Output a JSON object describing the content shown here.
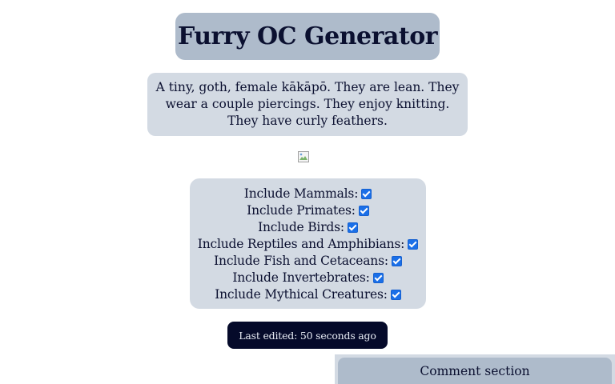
{
  "header": {
    "title": "Furry OC Generator"
  },
  "character": {
    "description": "A tiny, goth, female kākāpō. They are lean. They wear a couple piercings. They enjoy knitting. They have curly feathers."
  },
  "image": {
    "icon": "broken-image-icon"
  },
  "options": [
    {
      "label": "Include Mammals:",
      "checked": true
    },
    {
      "label": "Include Primates:",
      "checked": true
    },
    {
      "label": "Include Birds:",
      "checked": true
    },
    {
      "label": "Include Reptiles and Amphibians:",
      "checked": true
    },
    {
      "label": "Include Fish and Cetaceans:",
      "checked": true
    },
    {
      "label": "Include Invertebrates:",
      "checked": true
    },
    {
      "label": "Include Mythical Creatures:",
      "checked": true
    }
  ],
  "status": {
    "last_edited": "Last edited: 50 seconds ago"
  },
  "comments": {
    "header": "Comment section"
  },
  "colors": {
    "title_bg": "#aebbcb",
    "panel_bg": "#d3dae3",
    "status_bg": "#050a2a",
    "text": "#0b1030",
    "checkbox": "#1a6fe8"
  }
}
